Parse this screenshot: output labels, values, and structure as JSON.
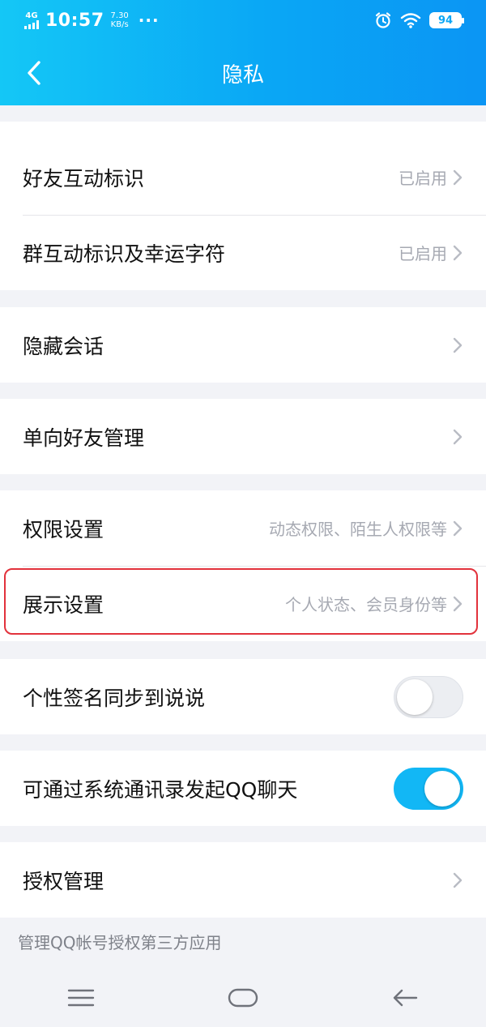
{
  "statusbar": {
    "network": "4G",
    "time": "10:57",
    "speed_value": "7.30",
    "speed_unit": "KB/s",
    "more": "···",
    "battery": "94"
  },
  "header": {
    "title": "隐私"
  },
  "rows": {
    "friend_interaction": {
      "label": "好友互动标识",
      "value": "已启用"
    },
    "group_interaction": {
      "label": "群互动标识及幸运字符",
      "value": "已启用"
    },
    "hidden_chats": {
      "label": "隐藏会话"
    },
    "one_way_friends": {
      "label": "单向好友管理"
    },
    "permissions": {
      "label": "权限设置",
      "value": "动态权限、陌生人权限等"
    },
    "display_settings": {
      "label": "展示设置",
      "value": "个人状态、会员身份等"
    },
    "signature_sync": {
      "label": "个性签名同步到说说",
      "enabled": false
    },
    "contacts_chat": {
      "label": "可通过系统通讯录发起QQ聊天",
      "enabled": true
    },
    "authorization": {
      "label": "授权管理"
    }
  },
  "footnote": "管理QQ帐号授权第三方应用",
  "colors": {
    "header_gradient_start": "#14c7f6",
    "header_gradient_end": "#0b95f4",
    "toggle_on": "#12b7f5",
    "highlight": "#e2323c"
  }
}
